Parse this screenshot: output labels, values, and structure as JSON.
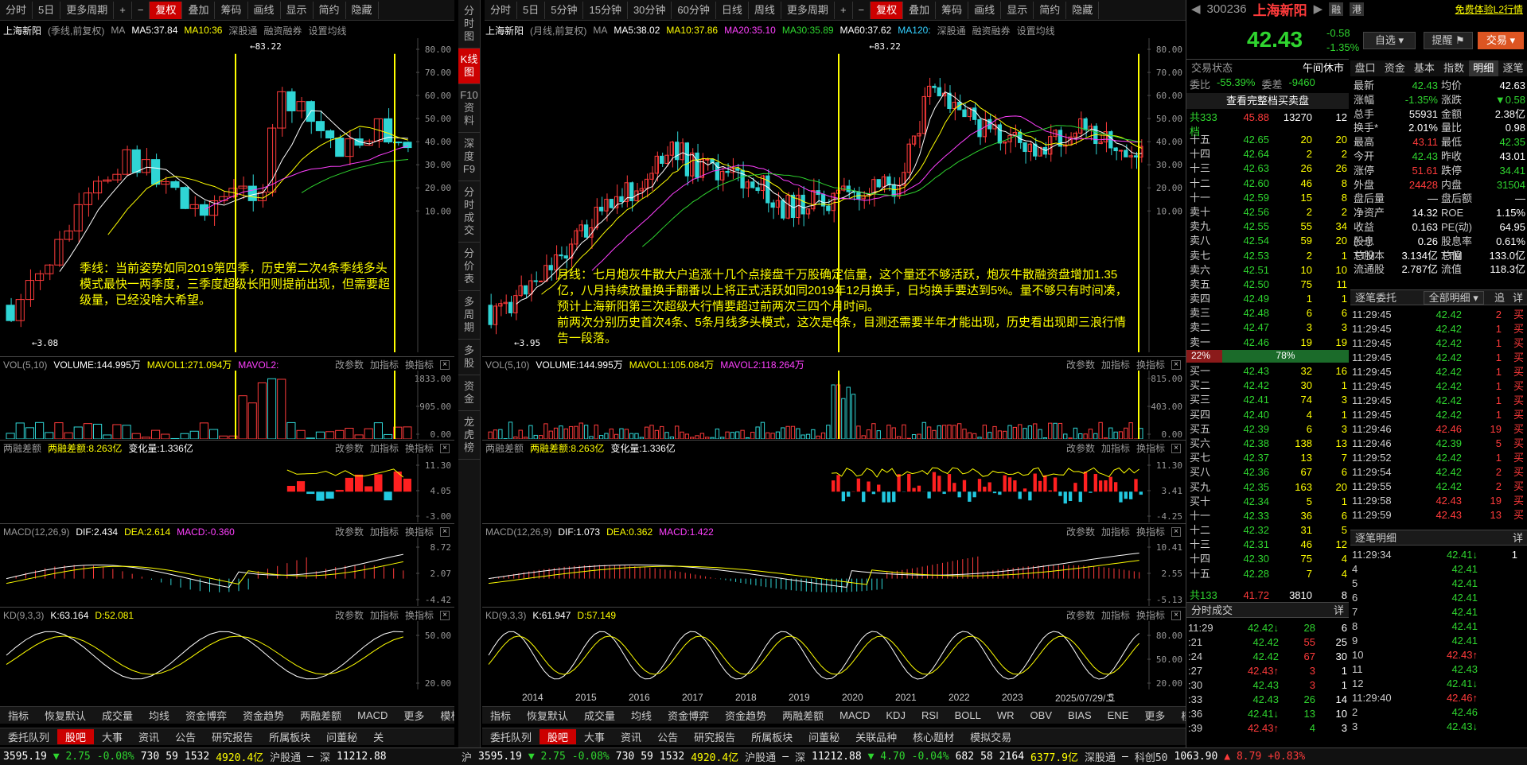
{
  "left_toolbar": [
    "分时",
    "5日",
    "更多周期",
    "+",
    "−",
    "复权",
    "叠加",
    "筹码",
    "画线",
    "显示",
    "简约",
    "隐藏"
  ],
  "mid_toolbar": [
    "分时",
    "5日",
    "5分钟",
    "15分钟",
    "30分钟",
    "60分钟",
    "日线",
    "周线",
    "更多周期",
    "+",
    "−",
    "复权",
    "叠加",
    "筹码",
    "画线",
    "显示",
    "简约",
    "隐藏"
  ],
  "left_panel": {
    "title": "上海新阳",
    "subtitle": "(季线,前复权)",
    "ma": [
      "MA",
      "MA5:37.84",
      "MA10:36",
      "深股通",
      "融资融券",
      "设置均线"
    ],
    "high_label": "83.22",
    "low_label": "3.08",
    "y_axis": [
      "80.00",
      "70.00",
      "60.00",
      "50.00",
      "40.00",
      "30.00",
      "20.00",
      "10.00"
    ],
    "annotation": "季线：当前姿势如同2019第四季，历史第二次4条季线多头模式最快一两季度，三季度超级长阳则提前出现，但需要超级量，已经没啥大希望。",
    "vol": [
      "VOL(5,10)",
      "VOLUME:144.995万",
      "MAVOL1:271.094万",
      "MAVOL2:",
      "改参数",
      "加指标",
      "换指标"
    ],
    "vol_axis": [
      "1833.00",
      "905.00",
      "0.00"
    ],
    "margin": [
      "两融差额",
      "两融差额:8.263亿",
      "变化量:1.336亿",
      "改参数",
      "加指标",
      "换指标"
    ],
    "margin_axis": [
      "11.30",
      "4.05",
      "-3.00"
    ],
    "macd": [
      "MACD(12,26,9)",
      "DIF:2.434",
      "DEA:2.614",
      "MACD:-0.360",
      "改参数",
      "加指标",
      "换指标"
    ],
    "macd_axis": [
      "8.72",
      "2.07",
      "-4.42"
    ],
    "kd": [
      "KD(9,3,3)",
      "K:63.164",
      "D:52.081",
      "改参数",
      "加指标",
      "换指标"
    ],
    "kd_axis": [
      "50.00",
      "20.00"
    ],
    "bottom_tabs": [
      "指标",
      "恢复默认",
      "成交量",
      "均线",
      "资金博弈",
      "资金趋势",
      "两融差额",
      "MACD",
      "更多",
      "模板"
    ]
  },
  "vtabs": [
    "分时图",
    "K线图",
    "F10资料",
    "深度F9",
    "分时成交",
    "分价表",
    "多周期",
    "多股",
    "资金",
    "龙虎榜"
  ],
  "mid_panel": {
    "title": "上海新阳",
    "subtitle": "(月线,前复权)",
    "ma": [
      "MA",
      "MA5:38.02",
      "MA10:37.86",
      "MA20:35.10",
      "MA30:35.89",
      "MA60:37.62",
      "MA120:",
      "深股通",
      "融资融券",
      "设置均线"
    ],
    "high_label": "83.22",
    "low_label": "3.95",
    "y_axis": [
      "80.00",
      "70.00",
      "60.00",
      "50.00",
      "40.00",
      "30.00",
      "20.00",
      "10.00"
    ],
    "annotation": "月线：七月炮灰牛散大户追涨十几个点接盘千万股确定信量，这个量还不够活跃，炮灰牛散融资盘增加1.35亿，八月持续放量换手翻番以上将正式活跃如同2019年12月换手，日均换手要达到5%。量不够只有时间凑，预计上海新阳第三次超级大行情要超过前两次三四个月时间。\n前两次分别历史首次4条、5条月线多头模式，这次是6条，目测还需要半年才能出现，历史看出现即三浪行情告一段落。",
    "vol": [
      "VOL(5,10)",
      "VOLUME:144.995万",
      "MAVOL1:105.084万",
      "MAVOL2:118.264万",
      "改参数",
      "加指标",
      "换指标"
    ],
    "vol_axis": [
      "815.00",
      "403.00",
      "0.00"
    ],
    "margin": [
      "两融差额",
      "两融差额:8.263亿",
      "变化量:1.336亿",
      "改参数",
      "加指标",
      "换指标"
    ],
    "margin_axis": [
      "11.30",
      "3.41",
      "-4.25"
    ],
    "macd": [
      "MACD(12,26,9)",
      "DIF:1.073",
      "DEA:0.362",
      "MACD:1.422",
      "改参数",
      "加指标",
      "换指标"
    ],
    "macd_axis": [
      "10.41",
      "2.55",
      "-5.13"
    ],
    "kd": [
      "KD(9,3,3)",
      "K:61.947",
      "D:57.149",
      "改参数",
      "加指标",
      "换指标"
    ],
    "kd_axis": [
      "80.00",
      "50.00",
      "20.00"
    ],
    "years": [
      "2014",
      "2015",
      "2016",
      "2017",
      "2018",
      "2019",
      "2020",
      "2021",
      "2022",
      "2023",
      "2025/07/29/二",
      "5"
    ],
    "bottom_tabs": [
      "指标",
      "恢复默认",
      "成交量",
      "均线",
      "资金博弈",
      "资金趋势",
      "两融差额",
      "MACD",
      "KDJ",
      "RSI",
      "BOLL",
      "WR",
      "OBV",
      "BIAS",
      "ENE",
      "更多",
      "模板"
    ]
  },
  "news_tabs_left": [
    "委托队列",
    "股吧",
    "大事",
    "资讯",
    "公告",
    "研究报告",
    "所属板块",
    "问董秘",
    "关"
  ],
  "news_tabs_mid": [
    "委托队列",
    "股吧",
    "大事",
    "资讯",
    "公告",
    "研究报告",
    "所属板块",
    "问董秘",
    "关联品种",
    "核心题材",
    "模拟交易"
  ],
  "right": {
    "code": "300236",
    "name": "上海新阳",
    "tag1": "融",
    "tag2": "港",
    "promo": "免费体验L2行情",
    "price": "42.43",
    "chg": "-0.58",
    "pct": "-1.35%",
    "btn1": "自选",
    "btn2": "提醒",
    "btn3": "交易",
    "status_label": "交易状态",
    "status": "午间休市",
    "wb_label": "委比",
    "wb": "-55.39%",
    "wc_label": "委差",
    "wc": "-9460",
    "full_btn": "查看完整档买卖盘",
    "sell_total": [
      "共333档",
      "45.88",
      "13270",
      "12"
    ],
    "asks": [
      [
        "十五",
        "42.65",
        "20",
        "20"
      ],
      [
        "十四",
        "42.64",
        "2",
        "2"
      ],
      [
        "十三",
        "42.63",
        "26",
        "26"
      ],
      [
        "十二",
        "42.60",
        "46",
        "8"
      ],
      [
        "十一",
        "42.59",
        "15",
        "8"
      ],
      [
        "卖十",
        "42.56",
        "2",
        "2"
      ],
      [
        "卖九",
        "42.55",
        "55",
        "34"
      ],
      [
        "卖八",
        "42.54",
        "59",
        "20"
      ],
      [
        "卖七",
        "42.53",
        "2",
        "1"
      ],
      [
        "卖六",
        "42.51",
        "10",
        "10"
      ],
      [
        "卖五",
        "42.50",
        "75",
        "11"
      ],
      [
        "卖四",
        "42.49",
        "1",
        "1"
      ],
      [
        "卖三",
        "42.48",
        "6",
        "6"
      ],
      [
        "卖二",
        "42.47",
        "3",
        "3"
      ],
      [
        "卖一",
        "42.46",
        "19",
        "19"
      ]
    ],
    "ratio": [
      "22%",
      "78%"
    ],
    "bids": [
      [
        "买一",
        "42.43",
        "32",
        "16"
      ],
      [
        "买二",
        "42.42",
        "30",
        "1"
      ],
      [
        "买三",
        "42.41",
        "74",
        "3"
      ],
      [
        "买四",
        "42.40",
        "4",
        "1"
      ],
      [
        "买五",
        "42.39",
        "6",
        "3"
      ],
      [
        "买六",
        "42.38",
        "138",
        "13"
      ],
      [
        "买七",
        "42.37",
        "13",
        "7"
      ],
      [
        "买八",
        "42.36",
        "67",
        "6"
      ],
      [
        "买九",
        "42.35",
        "163",
        "20"
      ],
      [
        "买十",
        "42.34",
        "5",
        "1"
      ],
      [
        "十一",
        "42.33",
        "36",
        "6"
      ],
      [
        "十二",
        "42.32",
        "31",
        "5"
      ],
      [
        "十三",
        "42.31",
        "46",
        "12"
      ],
      [
        "十四",
        "42.30",
        "75",
        "4"
      ],
      [
        "十五",
        "42.28",
        "7",
        "4"
      ]
    ],
    "buy_total": [
      "共133档",
      "41.72",
      "3810",
      "8"
    ],
    "tabs": [
      "盘口",
      "资金",
      "基本",
      "指数",
      "明细",
      "逐笔"
    ],
    "fin": [
      [
        "最新",
        "42.43",
        "均价",
        "42.63"
      ],
      [
        "涨幅",
        "-1.35%",
        "涨跌",
        "▼0.58"
      ],
      [
        "总手",
        "55931",
        "金额",
        "2.38亿"
      ],
      [
        "换手*",
        "2.01%",
        "量比",
        "0.98"
      ],
      [
        "最高",
        "43.11",
        "最低",
        "42.35"
      ],
      [
        "今开",
        "42.43",
        "昨收",
        "43.01"
      ],
      [
        "涨停",
        "51.61",
        "跌停",
        "34.41"
      ],
      [
        "外盘",
        "24428",
        "内盘",
        "31504"
      ],
      [
        "盘后量",
        "—",
        "盘后额",
        "—"
      ],
      [
        "净资产",
        "14.32",
        "ROE",
        "1.15%"
      ],
      [
        "收益(一)",
        "0.163",
        "PE(动)",
        "64.95"
      ],
      [
        "股息TTM",
        "0.26",
        "股息率TTM",
        "0.61%"
      ],
      [
        "总股本",
        "3.134亿",
        "总值",
        "133.0亿"
      ],
      [
        "流通股",
        "2.787亿",
        "流值",
        "118.3亿"
      ]
    ],
    "order_title": "逐笔委托",
    "order_filter": "全部明细",
    "order_btn1": "追",
    "order_btn2": "详",
    "orders": [
      [
        "11:29:45",
        "42.42",
        "2",
        "买"
      ],
      [
        "11:29:45",
        "42.42",
        "1",
        "买"
      ],
      [
        "11:29:45",
        "42.42",
        "1",
        "买"
      ],
      [
        "11:29:45",
        "42.42",
        "1",
        "买"
      ],
      [
        "11:29:45",
        "42.42",
        "1",
        "买"
      ],
      [
        "11:29:45",
        "42.42",
        "1",
        "买"
      ],
      [
        "11:29:45",
        "42.42",
        "1",
        "买"
      ],
      [
        "11:29:45",
        "42.42",
        "1",
        "买"
      ],
      [
        "11:29:46",
        "42.46",
        "19",
        "买"
      ],
      [
        "11:29:46",
        "42.39",
        "5",
        "买"
      ],
      [
        "11:29:52",
        "42.42",
        "1",
        "买"
      ],
      [
        "11:29:54",
        "42.42",
        "2",
        "买"
      ],
      [
        "11:29:55",
        "42.42",
        "2",
        "买"
      ],
      [
        "11:29:58",
        "42.43",
        "19",
        "买"
      ],
      [
        "11:29:59",
        "42.43",
        "13",
        "买"
      ]
    ],
    "detail_title": "逐笔明细",
    "detail_btn": "详",
    "details": [
      [
        "11:29:34",
        "42.41↓",
        "1"
      ],
      [
        "4",
        "42.41",
        ""
      ],
      [
        "5",
        "42.41",
        ""
      ],
      [
        "6",
        "42.41",
        ""
      ],
      [
        "7",
        "42.41",
        ""
      ],
      [
        "8",
        "42.41",
        ""
      ],
      [
        "9",
        "42.41",
        ""
      ],
      [
        "10",
        "42.43↑",
        ""
      ],
      [
        "11",
        "42.43",
        ""
      ],
      [
        "12",
        "42.41↓",
        ""
      ],
      [
        "11:29:40",
        "42.46↑",
        ""
      ],
      [
        "2",
        "42.46",
        ""
      ],
      [
        "3",
        "42.43↓",
        ""
      ]
    ],
    "ticks_title": "分时成交",
    "ticks_btn": "详",
    "ticks": [
      [
        "11:29",
        "42.42↓",
        "28",
        "6"
      ],
      [
        ":21",
        "42.42",
        "55",
        "25"
      ],
      [
        ":24",
        "42.42",
        "67",
        "30"
      ],
      [
        ":27",
        "42.43↑",
        "3",
        "1"
      ],
      [
        ":30",
        "42.43",
        "3",
        "1"
      ],
      [
        ":33",
        "42.43",
        "26",
        "14"
      ],
      [
        ":36",
        "42.41↓",
        "13",
        "10"
      ],
      [
        ":39",
        "42.43↑",
        "4",
        "3"
      ]
    ]
  },
  "status_bar": {
    "left": [
      "3595.19",
      "▼ 2.75",
      "-0.08%",
      "730",
      "59",
      "1532",
      "4920.4亿",
      "沪股通",
      "—",
      "深",
      "11212.88"
    ],
    "mid": [
      "沪",
      "3595.19",
      "▼ 2.75",
      "-0.08%",
      "730",
      "59",
      "1532",
      "4920.4亿",
      "沪股通",
      "—",
      "深",
      "11212.88",
      "▼ 4.70",
      "-0.04%",
      "682",
      "58",
      "2164",
      "6377.9亿",
      "深股通",
      "—",
      "科创50",
      "1063.90",
      "▲ 8.79",
      "+0.83%"
    ]
  }
}
